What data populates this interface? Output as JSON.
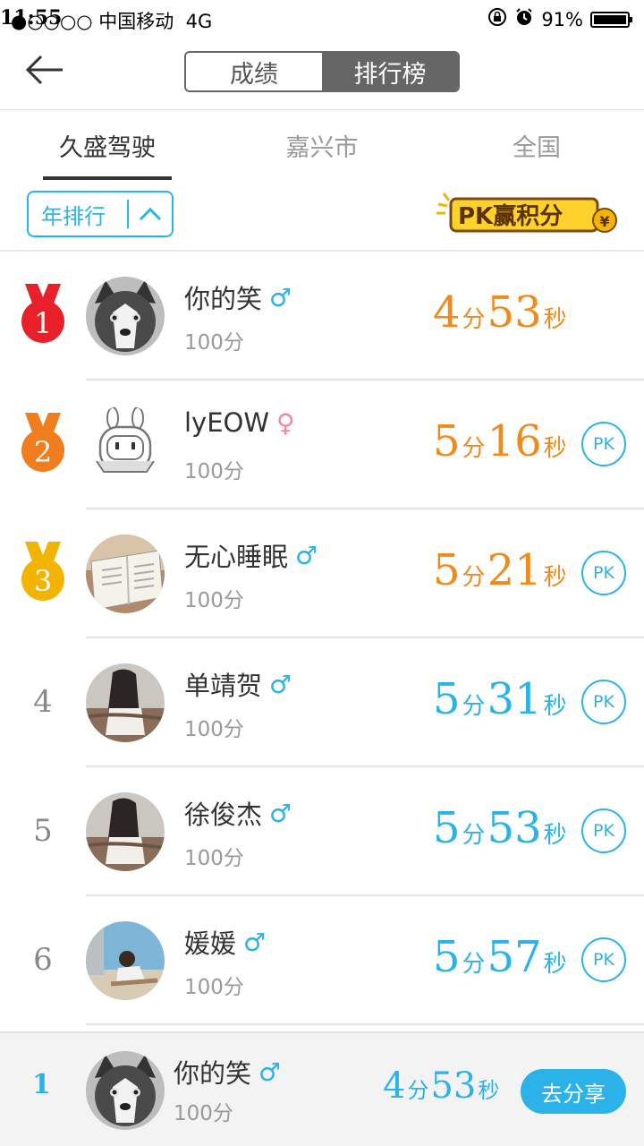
{
  "status_bar": {
    "carrier": "●○○○○ 中国移动",
    "network": "4G",
    "time": "11:55",
    "battery": "91%"
  },
  "nav": {
    "segments": [
      {
        "label": "成绩",
        "active": false
      },
      {
        "label": "排行榜",
        "active": true
      }
    ]
  },
  "region_tabs": [
    {
      "label": "久盛驾驶",
      "active": true
    },
    {
      "label": "嘉兴市",
      "active": false
    },
    {
      "label": "全国",
      "active": false
    }
  ],
  "filter": {
    "label": "年排行"
  },
  "banner": {
    "text": "PK赢积分",
    "currency": "¥"
  },
  "ranking": [
    {
      "rank": "1",
      "name": "你的笑",
      "gender": "male",
      "gender_symbol": "♂",
      "points": "100分",
      "min": "4",
      "sec": "53",
      "min_unit": "分",
      "sec_unit": "秒",
      "color": "orange",
      "pk": "",
      "medal_color": "#e8202a",
      "avatar": "husky"
    },
    {
      "rank": "2",
      "name": "lyEOW",
      "gender": "female",
      "gender_symbol": "♀",
      "points": "100分",
      "min": "5",
      "sec": "16",
      "min_unit": "分",
      "sec_unit": "秒",
      "color": "orange",
      "pk": "PK",
      "medal_color": "#f07d1e",
      "avatar": "robot"
    },
    {
      "rank": "3",
      "name": "无心睡眠",
      "gender": "male",
      "gender_symbol": "♂",
      "points": "100分",
      "min": "5",
      "sec": "21",
      "min_unit": "分",
      "sec_unit": "秒",
      "color": "orange",
      "pk": "PK",
      "medal_color": "#f2b400",
      "avatar": "book"
    },
    {
      "rank": "4",
      "name": "单靖贺",
      "gender": "male",
      "gender_symbol": "♂",
      "points": "100分",
      "min": "5",
      "sec": "31",
      "min_unit": "分",
      "sec_unit": "秒",
      "color": "blue",
      "pk": "PK",
      "avatar": "girl"
    },
    {
      "rank": "5",
      "name": "徐俊杰",
      "gender": "male",
      "gender_symbol": "♂",
      "points": "100分",
      "min": "5",
      "sec": "53",
      "min_unit": "分",
      "sec_unit": "秒",
      "color": "blue",
      "pk": "PK",
      "avatar": "girl"
    },
    {
      "rank": "6",
      "name": "媛媛",
      "gender": "male",
      "gender_symbol": "♂",
      "points": "100分",
      "min": "5",
      "sec": "57",
      "min_unit": "分",
      "sec_unit": "秒",
      "color": "blue",
      "pk": "PK",
      "avatar": "beach"
    }
  ],
  "my_rank": {
    "rank": "1",
    "name": "你的笑",
    "gender_symbol": "♂",
    "points": "100分",
    "min": "4",
    "sec": "53",
    "min_unit": "分",
    "sec_unit": "秒",
    "share_label": "去分享"
  }
}
